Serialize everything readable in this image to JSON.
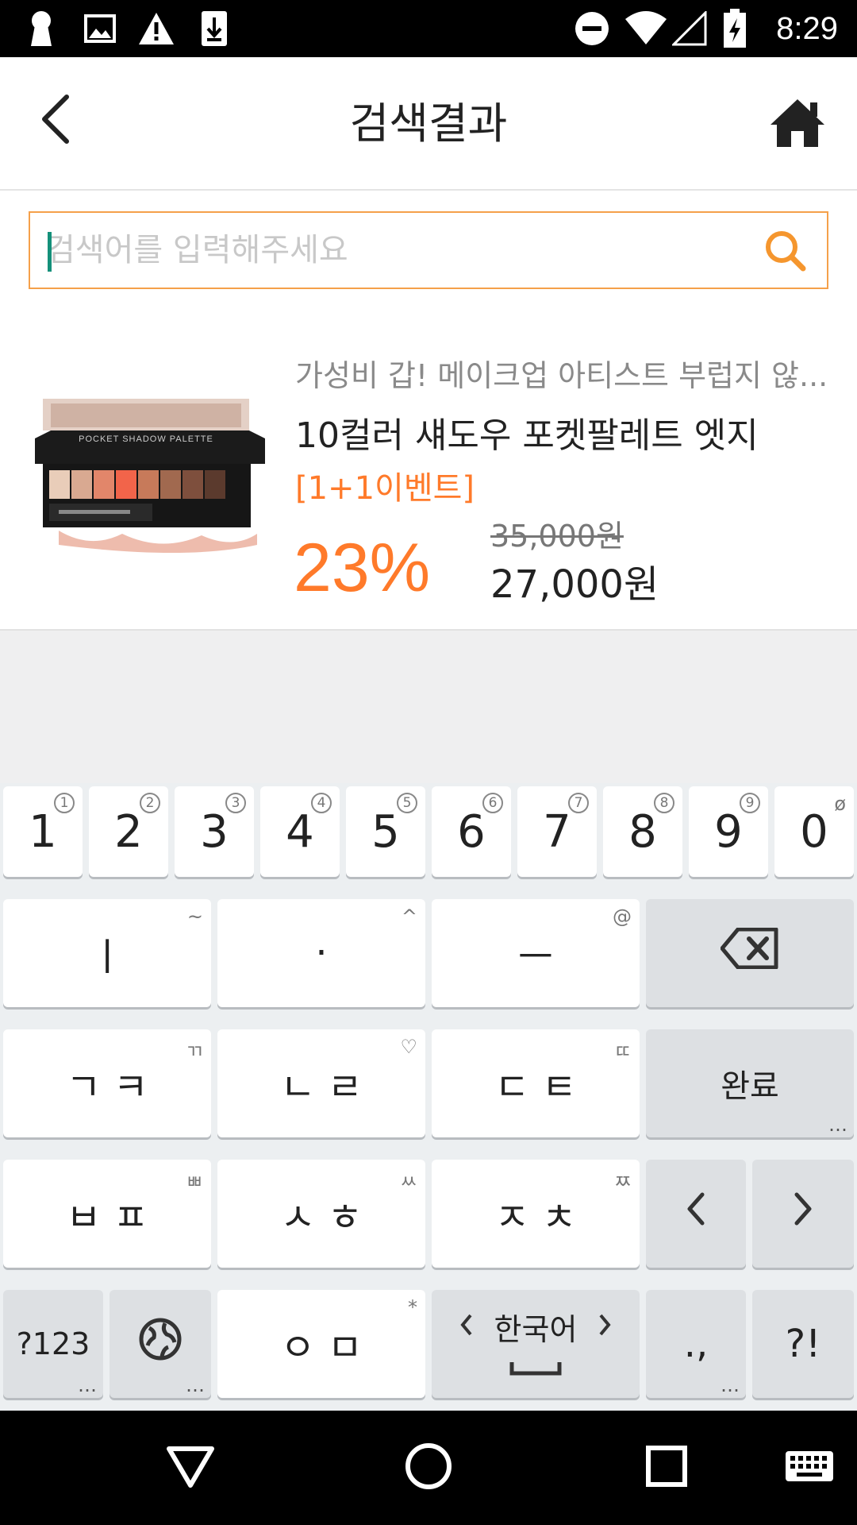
{
  "status_bar": {
    "time": "8:29",
    "icons": [
      "keyhole-icon",
      "image-icon",
      "warning-icon",
      "download-icon",
      "do-not-disturb-icon",
      "wifi-icon",
      "signal-icon",
      "battery-charging-icon"
    ]
  },
  "header": {
    "title": "검색결과",
    "back_icon": "chevron-left-icon",
    "home_icon": "home-icon"
  },
  "search": {
    "placeholder": "검색어를 입력해주세요",
    "value": "",
    "icon": "search-icon"
  },
  "product": {
    "subtitle": "가성비 갑! 메이크업 아티스트 부럽지 않...",
    "name": "10컬러 섀도우 포켓팔레트 엣지",
    "event": "[1+1이벤트]",
    "discount": "23%",
    "original_price": "35,000원",
    "price": "27,000원",
    "image": "eyeshadow-palette-image"
  },
  "keyboard": {
    "number_row": [
      {
        "label": "1",
        "hint": "1"
      },
      {
        "label": "2",
        "hint": "2"
      },
      {
        "label": "3",
        "hint": "3"
      },
      {
        "label": "4",
        "hint": "4"
      },
      {
        "label": "5",
        "hint": "5"
      },
      {
        "label": "6",
        "hint": "6"
      },
      {
        "label": "7",
        "hint": "7"
      },
      {
        "label": "8",
        "hint": "8"
      },
      {
        "label": "9",
        "hint": "9"
      },
      {
        "label": "0",
        "hint": "ø"
      }
    ],
    "row2": [
      {
        "label": "ㅣ",
        "hint": "~"
      },
      {
        "label": "·",
        "hint": "^"
      },
      {
        "label": "ㅡ",
        "hint": "@"
      }
    ],
    "row3": [
      {
        "label": "ㄱ ㅋ",
        "hint": "ㄲ"
      },
      {
        "label": "ㄴ ㄹ",
        "hint": "♡"
      },
      {
        "label": "ㄷ ㅌ",
        "hint": "ㄸ"
      }
    ],
    "done_label": "완료",
    "row4": [
      {
        "label": "ㅂ ㅍ",
        "hint": "ㅃ"
      },
      {
        "label": "ㅅ ㅎ",
        "hint": "ㅆ"
      },
      {
        "label": "ㅈ ㅊ",
        "hint": "ㅉ"
      }
    ],
    "symbols_label": "?123",
    "row5_middle": {
      "label": "ㅇ ㅁ",
      "hint": "*"
    },
    "space_label": "한국어",
    "punct_label": ".,",
    "excl_label": "?!",
    "more_dots": "…"
  },
  "nav_bar": {
    "icons": [
      "back-triangle-icon",
      "home-circle-icon",
      "recents-square-icon",
      "keyboard-icon"
    ]
  },
  "colors": {
    "accent": "#ff7a2a",
    "search_border": "#f5a04a",
    "cursor": "#14907a"
  }
}
